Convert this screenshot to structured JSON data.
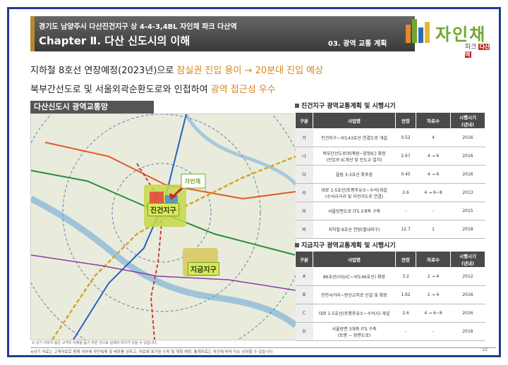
{
  "header": {
    "subtitle": "경기도 남양주시 다산진건지구 상 4-4-3,4BL 자인채 파크 다산역",
    "chapter": "Chapter Ⅱ. 다산 신도시의 이해",
    "section": "03. 광역 교통 계획"
  },
  "logo": {
    "name": "자인채",
    "sub": "파크",
    "badge": "다산역"
  },
  "headlines": [
    {
      "text": "지하철 8호선 연장예정(2023년)으로 ",
      "highlight": "잠실권 진입 용이 → 20분대 진입 예상"
    },
    {
      "text": "북부간선도로 및 서울외곽순환도로와 인접하여 ",
      "highlight": "광역 접근성 우수"
    }
  ],
  "map": {
    "title": "다산신도시 광역교통망",
    "districts": [
      "진건지구",
      "지금지구"
    ],
    "note": "※ 상기 이미지 등은 고객의 이해를 돕기 위한 것으로 실제와 차이가 있을 수 있습니다.",
    "logo_label": "자인채"
  },
  "table1": {
    "title": "진건지구 광역교통계획 및 시행시기",
    "headers": [
      "구분",
      "사업명",
      "연장",
      "차로수",
      "시행시기\n(년내)"
    ],
    "rows": [
      [
        "가",
        "진건지구~국도43호선 연결도로 개설",
        "0.52",
        "4",
        "2016"
      ],
      [
        "나",
        "북부간선도로(퇴계원~양정IC) 확장\n(진입로:IC개선 및 인도교 설치)",
        "2.67",
        "4 → 6",
        "2016"
      ],
      [
        "다",
        "올림 3-3호선 확포장",
        "0.45",
        "4 → 6",
        "2016"
      ],
      [
        "라",
        "대로 1-5호선(토평주유소~수석)개설\n(수석사거리 및 자전거도로 연결)",
        "2.6",
        "4 → 6~8",
        "2013"
      ],
      [
        "마",
        "서울방면도로 ITS 3개축 구축",
        "-",
        "-",
        "2015"
      ],
      [
        "바",
        "지하철 8호선 연장(별내지구)",
        "12.7",
        "1",
        "2018"
      ]
    ]
  },
  "table2": {
    "title": "지금지구 광역교통계획 및 시행시기",
    "headers": [
      "구분",
      "사업명",
      "연장",
      "차로수",
      "시행시기\n(년내)"
    ],
    "rows": [
      [
        "A",
        "86호선(사능IC~국도46호선) 확장",
        "3.2",
        "2 → 4",
        "2012"
      ],
      [
        "B",
        "진안사거리~판산교차로 신설 및 확장",
        "1.62",
        "2 → 4",
        "2016"
      ],
      [
        "C",
        "대로 1-5호선(토평주유소~수석시) 개설",
        "2.6",
        "4 → 6~8",
        "2016"
      ],
      [
        "D",
        "서울방면 3개축 ITS 구축\n(토평 ~ 장변도로)",
        "-",
        "-",
        "2016"
      ]
    ]
  },
  "footer": {
    "disclaimer": "※상기 자료는 고객자료로 참제 외부에 무단복제 및 배포를 금하고, 자료에 표기된 수치 및 계획 예정, 통계자료는 여건에 따라 다소 상이할 수 있습니다.",
    "page": "12"
  },
  "colors": {
    "frame": "#1e3d8f",
    "accent": "#d4871d",
    "header": "#4a4a4a",
    "logo_green": "#6fa832"
  }
}
